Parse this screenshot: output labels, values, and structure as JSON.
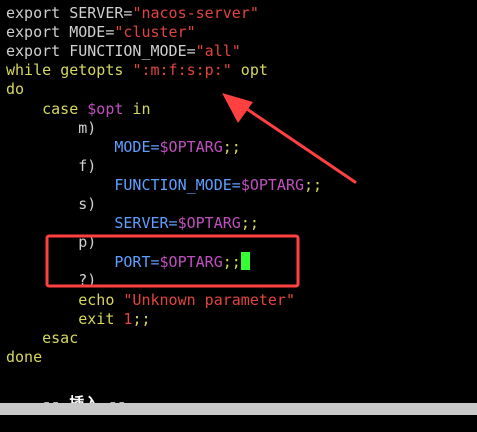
{
  "colors": {
    "background": "#000000",
    "keyword": "#d7d75f",
    "identifier": "#d0d0d0",
    "string": "#e0443e",
    "variable": "#c050c0",
    "assignment": "#5f9fff",
    "number": "#e0443e",
    "cursor": "#33ff33",
    "status": "#ffffff",
    "annotation": "#ff4040",
    "bottom_strip": "#c8c8c8"
  },
  "editor": {
    "lines": [
      [
        {
          "t": "export ",
          "c": "identifier"
        },
        {
          "t": "SERVER=",
          "c": "identifier"
        },
        {
          "t": "\"nacos-server\"",
          "c": "string"
        }
      ],
      [
        {
          "t": "export ",
          "c": "identifier"
        },
        {
          "t": "MODE=",
          "c": "identifier"
        },
        {
          "t": "\"cluster\"",
          "c": "string"
        }
      ],
      [
        {
          "t": "export ",
          "c": "identifier"
        },
        {
          "t": "FUNCTION_MODE=",
          "c": "identifier"
        },
        {
          "t": "\"all\"",
          "c": "string"
        }
      ],
      [
        {
          "t": "while ",
          "c": "keyword"
        },
        {
          "t": "getopts ",
          "c": "keyword"
        },
        {
          "t": "\":m:f:s:p:\"",
          "c": "string"
        },
        {
          "t": " opt",
          "c": "keyword"
        }
      ],
      [
        {
          "t": "do",
          "c": "keyword"
        }
      ],
      [
        {
          "t": "    case ",
          "c": "keyword"
        },
        {
          "t": "$opt",
          "c": "variable"
        },
        {
          "t": " in",
          "c": "keyword"
        }
      ],
      [
        {
          "t": "        m)",
          "c": "identifier"
        }
      ],
      [
        {
          "t": "            MODE=",
          "c": "assignment"
        },
        {
          "t": "$OPTARG",
          "c": "variable"
        },
        {
          "t": ";;",
          "c": "keyword"
        }
      ],
      [
        {
          "t": "        f)",
          "c": "identifier"
        }
      ],
      [
        {
          "t": "            FUNCTION_MODE=",
          "c": "assignment"
        },
        {
          "t": "$OPTARG",
          "c": "variable"
        },
        {
          "t": ";;",
          "c": "keyword"
        }
      ],
      [
        {
          "t": "        s)",
          "c": "identifier"
        }
      ],
      [
        {
          "t": "            SERVER=",
          "c": "assignment"
        },
        {
          "t": "$OPTARG",
          "c": "variable"
        },
        {
          "t": ";;",
          "c": "keyword"
        }
      ],
      [
        {
          "t": "        p)",
          "c": "identifier"
        }
      ],
      [
        {
          "t": "            PORT=",
          "c": "assignment"
        },
        {
          "t": "$OPTARG",
          "c": "variable"
        },
        {
          "t": ";;",
          "c": "keyword"
        },
        {
          "t": "",
          "c": "cursor"
        }
      ],
      [
        {
          "t": "        ?)",
          "c": "identifier"
        }
      ],
      [
        {
          "t": "        echo ",
          "c": "keyword"
        },
        {
          "t": "\"Unknown parameter\"",
          "c": "string"
        }
      ],
      [
        {
          "t": "        exit ",
          "c": "keyword"
        },
        {
          "t": "1",
          "c": "number"
        },
        {
          "t": ";;",
          "c": "keyword"
        }
      ],
      [
        {
          "t": "    esac",
          "c": "keyword"
        }
      ],
      [
        {
          "t": "done",
          "c": "keyword"
        }
      ]
    ],
    "status_line": "-- 插入 --"
  }
}
